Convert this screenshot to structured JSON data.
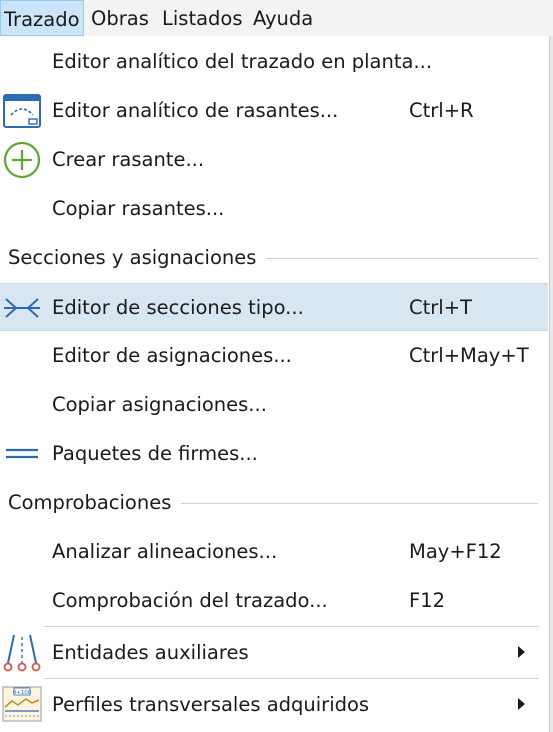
{
  "menubar": {
    "items": [
      {
        "label": "Trazado",
        "active": true
      },
      {
        "label": "Obras"
      },
      {
        "label": "Listados"
      },
      {
        "label": "Ayuda"
      }
    ]
  },
  "menu": {
    "items": [
      {
        "label": "Editor analítico del trazado en planta...",
        "shortcut": ""
      },
      {
        "label": "Editor analítico de rasantes...",
        "shortcut": "Ctrl+R",
        "icon": "profile-editor-icon"
      },
      {
        "label": "Crear rasante...",
        "shortcut": "",
        "icon": "add-circle-icon"
      },
      {
        "label": "Copiar rasantes...",
        "shortcut": ""
      },
      {
        "label": "Editor de secciones tipo...",
        "shortcut": "Ctrl+T",
        "icon": "cross-section-icon"
      },
      {
        "label": "Editor de asignaciones...",
        "shortcut": "Ctrl+May+T"
      },
      {
        "label": "Copiar asignaciones...",
        "shortcut": ""
      },
      {
        "label": "Paquetes de firmes...",
        "shortcut": "",
        "icon": "pavement-layers-icon"
      },
      {
        "label": "Analizar alineaciones...",
        "shortcut": "May+F12"
      },
      {
        "label": "Comprobación del trazado...",
        "shortcut": "F12"
      },
      {
        "label": "Entidades auxiliares",
        "submenu": true,
        "icon": "auxiliary-entities-icon"
      },
      {
        "label": "Perfiles transversales adquiridos",
        "submenu": true,
        "icon": "acquired-profiles-icon"
      }
    ],
    "sections": [
      {
        "title": "Secciones y asignaciones"
      },
      {
        "title": "Comprobaciones"
      }
    ],
    "icon_label_small": "0+100"
  },
  "colors": {
    "accent_blue": "#2e6ab1",
    "green": "#5aa832",
    "hover_bg": "#d8e6f2",
    "red_marker": "#d9534f"
  }
}
